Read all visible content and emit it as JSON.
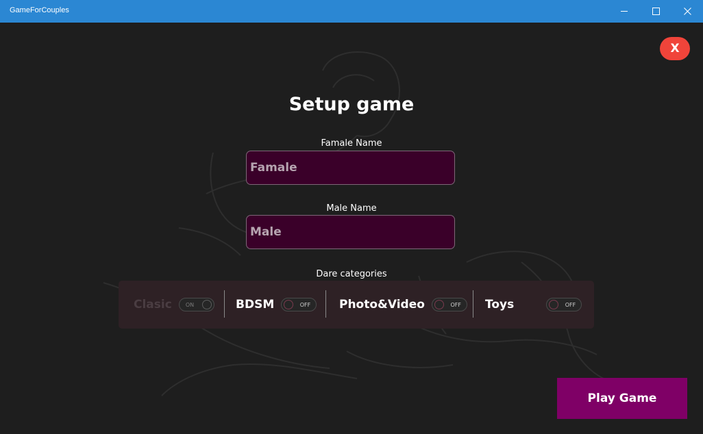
{
  "window": {
    "title": "GameForCouples",
    "controls": [
      "minimize-icon",
      "maximize-icon",
      "close-icon"
    ]
  },
  "exit_button": {
    "label": "X",
    "color": "#f0443a"
  },
  "page": {
    "title": "Setup game"
  },
  "female": {
    "label": "Famale Name",
    "placeholder": "Famale"
  },
  "male": {
    "label": "Male Name",
    "placeholder": "Male"
  },
  "categories": {
    "label": "Dare categories",
    "items": [
      {
        "label": "Clasic",
        "state": "ON",
        "enabled": false
      },
      {
        "label": "BDSM",
        "state": "OFF",
        "enabled": true
      },
      {
        "label": "Photo&Video",
        "state": "OFF",
        "enabled": true
      },
      {
        "label": "Toys",
        "state": "OFF",
        "enabled": true
      }
    ]
  },
  "play_button": {
    "label": "Play Game",
    "color": "#7f0066"
  },
  "colors": {
    "titlebar": "#2b87d3",
    "background": "#1e1e1e",
    "input_bg": "#3a0029"
  }
}
